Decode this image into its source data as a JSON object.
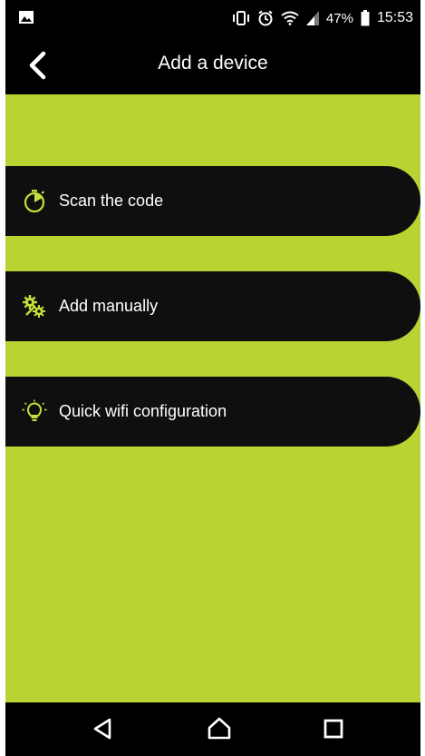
{
  "status_bar": {
    "battery_percent": "47%",
    "time": "15:53",
    "icons": [
      "image-icon",
      "vibrate-icon",
      "alarm-icon",
      "wifi-icon",
      "signal-icon",
      "battery-icon"
    ]
  },
  "app_bar": {
    "title": "Add a device",
    "back_icon": "chevron-left-icon"
  },
  "menu": {
    "items": [
      {
        "label": "Scan the code",
        "icon": "stopwatch-icon"
      },
      {
        "label": "Add manually",
        "icon": "gears-icon"
      },
      {
        "label": "Quick wifi configuration",
        "icon": "lightbulb-icon"
      }
    ]
  },
  "nav_bar": {
    "icons": [
      "back-triangle-icon",
      "home-icon",
      "recents-icon"
    ]
  },
  "colors": {
    "background": "#b9d432",
    "bar": "#000000",
    "item": "#0f0f10",
    "accent": "#c6e03a"
  }
}
